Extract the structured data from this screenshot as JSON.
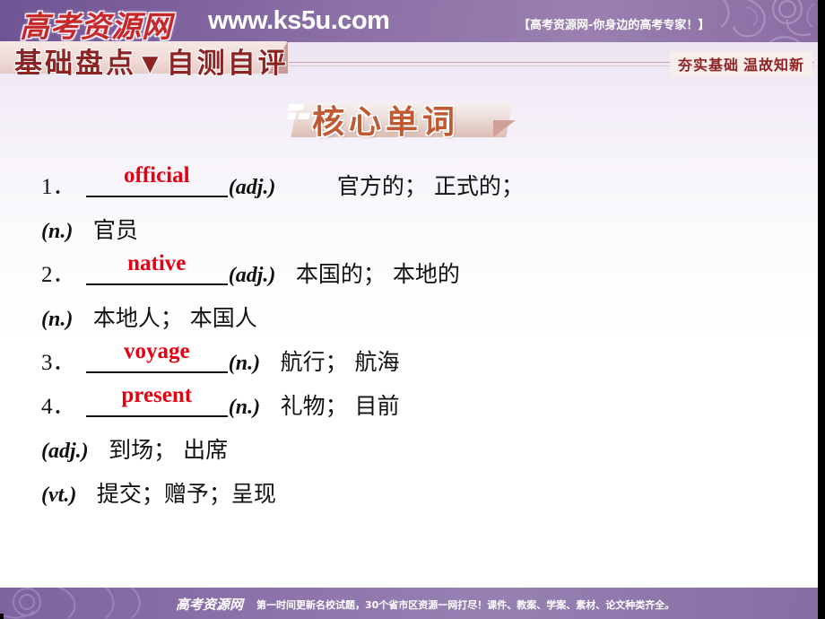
{
  "header": {
    "logo_cn": "高考资源网",
    "logo_url": "www.ks5u.com",
    "slogan": "【高考资源网-你身边的高考专家！】"
  },
  "section": {
    "ribbon_title": "基础盘点▼自测自评",
    "right_tag": "夯实基础  温故知新"
  },
  "main_banner": {
    "title": "核心单词"
  },
  "words": [
    {
      "number": "1．",
      "answer": "official",
      "pos": "(adj.)",
      "meaning": "官方的；  正式的；",
      "extra_pos": "(n.)",
      "extra_meaning": "官员"
    },
    {
      "number": "2．",
      "answer": "native",
      "pos": "(adj.)",
      "meaning": "本国的；  本地的",
      "extra_pos": "(n.)",
      "extra_meaning": "本地人；  本国人"
    },
    {
      "number": "3．",
      "answer": "voyage",
      "pos": "(n.)",
      "meaning": "航行；  航海"
    },
    {
      "number": "4．",
      "answer": "present",
      "pos": "(n.)",
      "meaning": "礼物；  目前",
      "extra_pos": "(adj.)",
      "extra_meaning": "到场；  出席",
      "extra_pos2": "(vt.)",
      "extra_meaning2": "提交；赠予；呈现"
    }
  ],
  "footer": {
    "logo": "高考资源网",
    "text": "第一时间更新名校试题，30个省市区资源一网打尽！课件、教案、学案、素材、论文种类齐全。"
  },
  "colors": {
    "banner_purple": "#8f73a8",
    "answer_red": "#e60012",
    "title_dark_red": "#8e2323",
    "main_title_orange": "#c05a33"
  }
}
